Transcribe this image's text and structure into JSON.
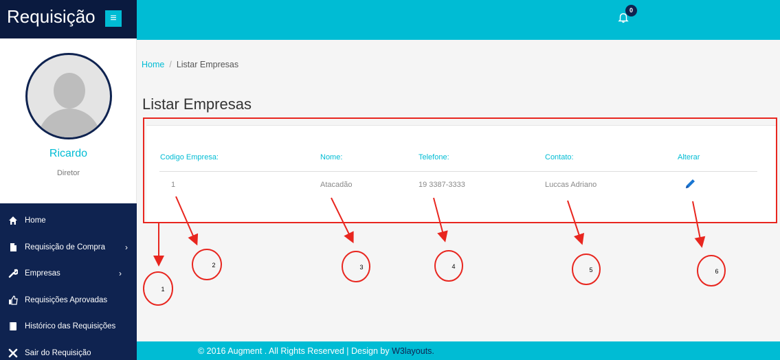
{
  "brand": {
    "title": "Requisição",
    "menu_icon": "menu-icon"
  },
  "profile": {
    "name": "Ricardo",
    "role": "Diretor"
  },
  "nav": [
    {
      "label": "Home",
      "icon": "home-icon"
    },
    {
      "label": "Requisição de Compra",
      "icon": "file-icon",
      "arrow": "›"
    },
    {
      "label": "Empresas",
      "icon": "wrench-icon",
      "arrow": "›"
    },
    {
      "label": "Requisições Aprovadas",
      "icon": "thumbs-up-icon"
    },
    {
      "label": "Histórico das Requisições",
      "icon": "book-icon"
    },
    {
      "label": "Sair do Requisição",
      "icon": "close-icon"
    }
  ],
  "topbar": {
    "notification_count": "0"
  },
  "breadcrumb": {
    "home": "Home",
    "separator": "/",
    "current": "Listar Empresas"
  },
  "page_title": "Listar Empresas",
  "table": {
    "headers": [
      "Codigo Empresa:",
      "Nome:",
      "Telefone:",
      "Contato:",
      "Alterar"
    ],
    "rows": [
      {
        "codigo": "1",
        "nome": "Atacadão",
        "telefone": "19 3387-3333",
        "contato": "Luccas Adriano"
      }
    ]
  },
  "annotations": [
    "1",
    "2",
    "3",
    "4",
    "5",
    "6"
  ],
  "colors": {
    "accent": "#00bcd4",
    "sidebar": "#0f2350",
    "annotation": "#e8261f"
  },
  "footer": {
    "text": "© 2016 Augment . All Rights Reserved | Design by ",
    "link": "W3layouts."
  }
}
